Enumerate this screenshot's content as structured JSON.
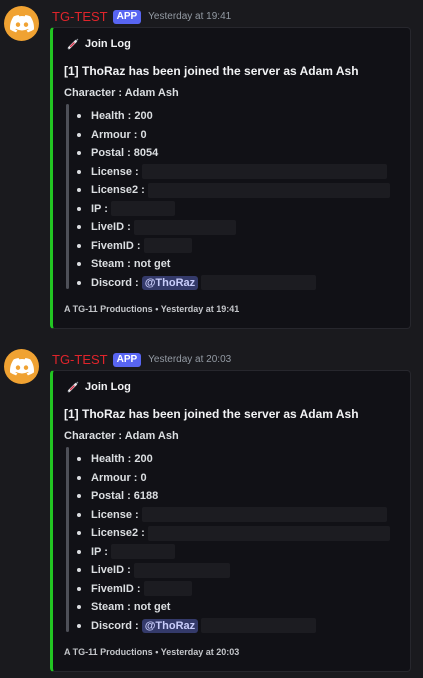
{
  "messages": [
    {
      "username": "TG-TEST",
      "badge": "APP",
      "timestamp": "Yesterday at 19:41",
      "embed": {
        "author": "Join Log",
        "author_icon": "syringe-icon",
        "title": "[1] ThoRaz has been joined the server as Adam Ash",
        "character": "Character : Adam Ash",
        "fields": [
          {
            "label": "Health :",
            "value": "200"
          },
          {
            "label": "Armour :",
            "value": "0"
          },
          {
            "label": "Postal :",
            "value": "8054"
          },
          {
            "label": "License :",
            "value": ""
          },
          {
            "label": "License2 :",
            "value": ""
          },
          {
            "label": "IP :",
            "value": ""
          },
          {
            "label": "LiveID :",
            "value": ""
          },
          {
            "label": "FivemID :",
            "value": ""
          },
          {
            "label": "Steam :",
            "value": "not get"
          },
          {
            "label": "Discord :",
            "value": "@ThoRaz"
          }
        ],
        "footer_text": "A TG-11 Productions",
        "footer_sep": "•",
        "footer_time": "Yesterday at 19:41"
      }
    },
    {
      "username": "TG-TEST",
      "badge": "APP",
      "timestamp": "Yesterday at 20:03",
      "embed": {
        "author": "Join Log",
        "author_icon": "syringe-icon",
        "title": "[1] ThoRaz has been joined the server as Adam Ash",
        "character": "Character : Adam Ash",
        "fields": [
          {
            "label": "Health :",
            "value": "200"
          },
          {
            "label": "Armour :",
            "value": "0"
          },
          {
            "label": "Postal :",
            "value": "6188"
          },
          {
            "label": "License :",
            "value": ""
          },
          {
            "label": "License2 :",
            "value": ""
          },
          {
            "label": "IP :",
            "value": ""
          },
          {
            "label": "LiveID :",
            "value": ""
          },
          {
            "label": "FivemID :",
            "value": ""
          },
          {
            "label": "Steam :",
            "value": "not get"
          },
          {
            "label": "Discord :",
            "value": "@ThoRaz"
          }
        ],
        "footer_text": "A TG-11 Productions",
        "footer_sep": "•",
        "footer_time": "Yesterday at 20:03"
      }
    }
  ],
  "colors": {
    "background": "#1a1a1e",
    "username": "#e0242b",
    "badge": "#5865f2",
    "embed_accent": "#22c522",
    "embed_bg": "#111116",
    "avatar": "#f0a232",
    "mention_bg": "#343a6a"
  }
}
